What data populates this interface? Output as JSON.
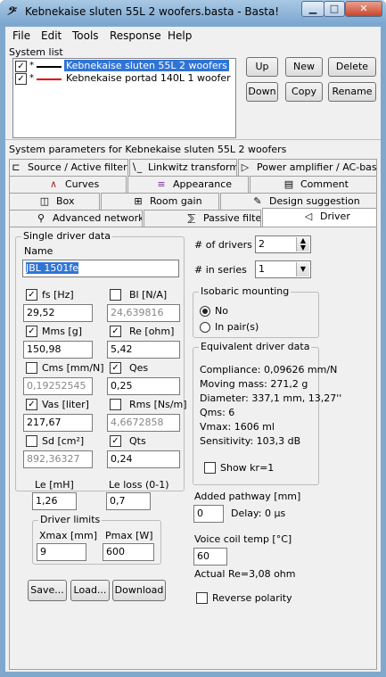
{
  "window": {
    "title": "Kebnekaise sluten 55L 2 woofers.basta - Basta!",
    "app_icon": "basta-icon"
  },
  "titlebar_buttons": {
    "minimize": "▁",
    "maximize": "□",
    "close": "✕"
  },
  "menu": [
    "File",
    "Edit",
    "Tools",
    "Response",
    "Help"
  ],
  "system_list": {
    "label": "System list",
    "items": [
      {
        "checked": true,
        "star": "*",
        "color": "#000000",
        "name": "Kebnekaise sluten 55L 2 woofers",
        "selected": true
      },
      {
        "checked": true,
        "star": "*",
        "color": "#e00000",
        "name": "Kebnekaise portad 140L 1 woofer",
        "selected": false
      }
    ],
    "buttons": {
      "up": "Up",
      "new": "New",
      "delete": "Delete",
      "down": "Down",
      "copy": "Copy",
      "rename": "Rename"
    }
  },
  "params_label": "System parameters for Kebnekaise sluten 55L 2 woofers",
  "tabs": {
    "row1": [
      {
        "label": "Source / Active filter",
        "icon": "speaker-icon"
      },
      {
        "label": "Linkwitz transform",
        "icon": "linkwitz-icon"
      },
      {
        "label": "Power amplifier / AC-bass",
        "icon": "amplifier-icon"
      }
    ],
    "row2": [
      {
        "label": "Curves",
        "icon": "curves-icon"
      },
      {
        "label": "Appearance",
        "icon": "appearance-icon"
      },
      {
        "label": "Comment",
        "icon": "comment-icon"
      }
    ],
    "row3": [
      {
        "label": "Box",
        "icon": "box-icon"
      },
      {
        "label": "Room gain",
        "icon": "room-icon"
      },
      {
        "label": "Design suggestion",
        "icon": "pencil-icon"
      }
    ],
    "row4": [
      {
        "label": "Advanced network",
        "icon": "network-icon"
      },
      {
        "label": "Passive filter",
        "icon": "filter-icon"
      },
      {
        "label": "Driver",
        "icon": "driver-icon"
      }
    ]
  },
  "driver": {
    "group_label": "Single driver data",
    "name_label": "Name",
    "name_value": "JBL 1501fe",
    "params": [
      {
        "label": "fs [Hz]",
        "checked": true,
        "value": "29,52",
        "enabled": true
      },
      {
        "label": "Bl [N/A]",
        "checked": false,
        "value": "24,639816",
        "enabled": false
      },
      {
        "label": "Mms [g]",
        "checked": true,
        "value": "150,98",
        "enabled": true
      },
      {
        "label": "Re [ohm]",
        "checked": true,
        "value": "5,42",
        "enabled": true
      },
      {
        "label": "Cms [mm/N]",
        "checked": false,
        "value": "0,19252545",
        "enabled": false
      },
      {
        "label": "Qes",
        "checked": true,
        "value": "0,25",
        "enabled": true
      },
      {
        "label": "Vas [liter]",
        "checked": true,
        "value": "217,67",
        "enabled": true
      },
      {
        "label": "Rms [Ns/m]",
        "checked": false,
        "value": "4,6672858",
        "enabled": false
      },
      {
        "label": "Sd [cm²]",
        "checked": false,
        "value": "892,36327",
        "enabled": false
      },
      {
        "label": "Qts",
        "checked": true,
        "value": "0,24",
        "enabled": true
      }
    ],
    "le_label": "Le [mH]",
    "le_value": "1,26",
    "leloss_label": "Le loss (0-1)",
    "leloss_value": "0,7",
    "limits_label": "Driver limits",
    "xmax_label": "Xmax [mm]",
    "xmax_value": "9",
    "pmax_label": "Pmax [W]",
    "pmax_value": "600",
    "buttons": {
      "save": "Save...",
      "load": "Load...",
      "download": "Download"
    }
  },
  "right": {
    "num_drivers_label": "# of drivers",
    "num_drivers_value": "2",
    "in_series_label": "# in series",
    "in_series_value": "1",
    "isobaric_label": "Isobaric mounting",
    "radio_no": "No",
    "radio_pairs": "In pair(s)",
    "equiv_label": "Equivalent driver data",
    "equiv_lines": [
      "Compliance: 0,09626 mm/N",
      "Moving mass: 271,2 g",
      "Diameter: 337,1 mm, 13,27''",
      "Qms: 6",
      "Vmax: 1606 ml",
      "Sensitivity: 103,3 dB"
    ],
    "show_kr": "Show kr=1",
    "pathway_label": "Added pathway [mm]",
    "pathway_value": "0",
    "delay_text": "Delay: 0 µs",
    "coil_label": "Voice coil temp [°C]",
    "coil_value": "60",
    "actual_re": "Actual Re=3,08 ohm",
    "reverse_polarity": "Reverse polarity"
  }
}
